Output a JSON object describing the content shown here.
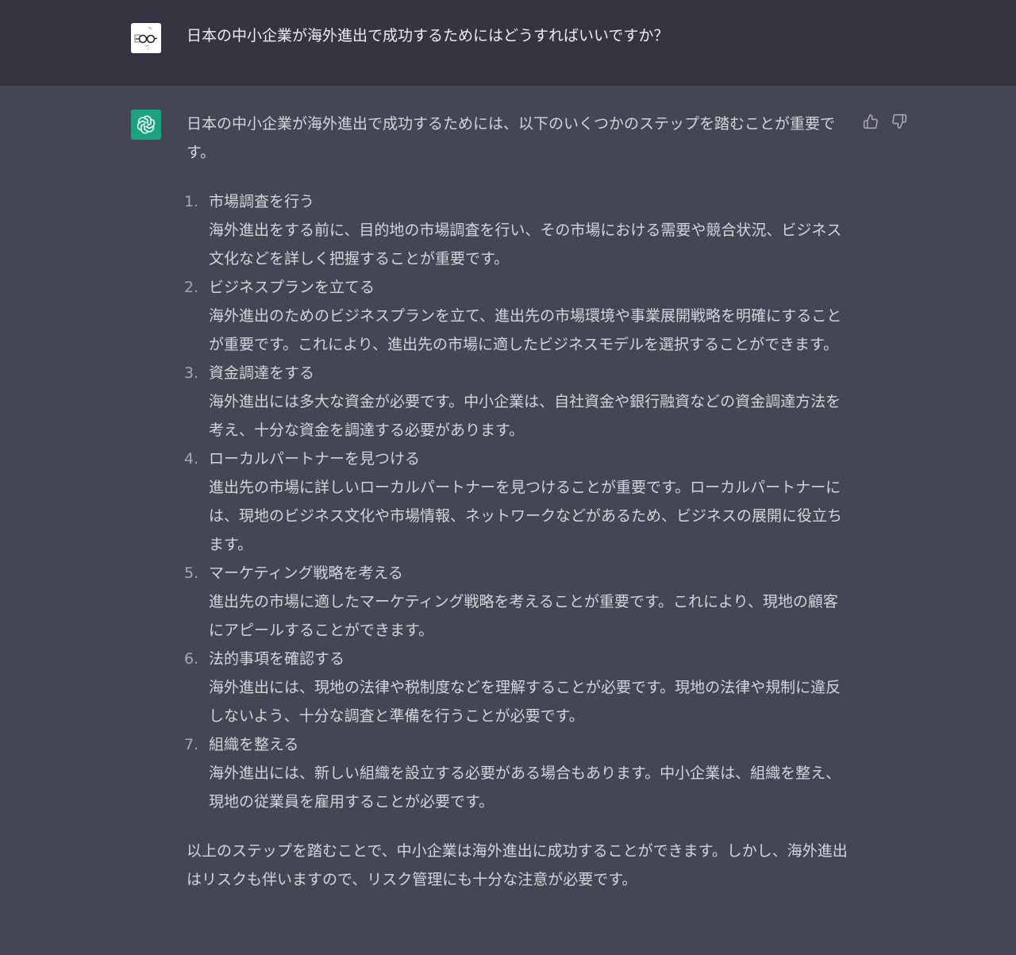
{
  "user_message": {
    "text": "日本の中小企業が海外進出で成功するためにはどうすればいいですか？"
  },
  "assistant_message": {
    "intro": "日本の中小企業が海外進出で成功するためには、以下のいくつかのステップを踏むことが重要です。",
    "steps": [
      {
        "number": "1.",
        "title": "市場調査を行う",
        "body": "海外進出をする前に、目的地の市場調査を行い、その市場における需要や競合状況、ビジネス文化などを詳しく把握することが重要です。"
      },
      {
        "number": "2.",
        "title": "ビジネスプランを立てる",
        "body": "海外進出のためのビジネスプランを立て、進出先の市場環境や事業展開戦略を明確にすることが重要です。これにより、進出先の市場に適したビジネスモデルを選択することができます。"
      },
      {
        "number": "3.",
        "title": "資金調達をする",
        "body": "海外進出には多大な資金が必要です。中小企業は、自社資金や銀行融資などの資金調達方法を考え、十分な資金を調達する必要があります。"
      },
      {
        "number": "4.",
        "title": "ローカルパートナーを見つける",
        "body": "進出先の市場に詳しいローカルパートナーを見つけることが重要です。ローカルパートナーには、現地のビジネス文化や市場情報、ネットワークなどがあるため、ビジネスの展開に役立ちます。"
      },
      {
        "number": "5.",
        "title": "マーケティング戦略を考える",
        "body": "進出先の市場に適したマーケティング戦略を考えることが重要です。これにより、現地の顧客にアピールすることができます。"
      },
      {
        "number": "6.",
        "title": "法的事項を確認する",
        "body": "海外進出には、現地の法律や税制度などを理解することが必要です。現地の法律や規制に違反しないよう、十分な調査と準備を行うことが必要です。"
      },
      {
        "number": "7.",
        "title": "組織を整える",
        "body": "海外進出には、新しい組織を設立する必要がある場合もあります。中小企業は、組織を整え、現地の従業員を雇用することが必要です。"
      }
    ],
    "conclusion": "以上のステップを踏むことで、中小企業は海外進出に成功することができます。しかし、海外進出はリスクも伴いますので、リスク管理にも十分な注意が必要です。"
  },
  "icons": {
    "user_avatar": "user-avatar-icon",
    "bot_avatar": "openai-logo-icon",
    "thumbs_up": "thumbs-up-icon",
    "thumbs_down": "thumbs-down-icon"
  },
  "colors": {
    "user_bg": "#343541",
    "assistant_bg": "#444654",
    "bot_avatar_bg": "#19a37f"
  }
}
